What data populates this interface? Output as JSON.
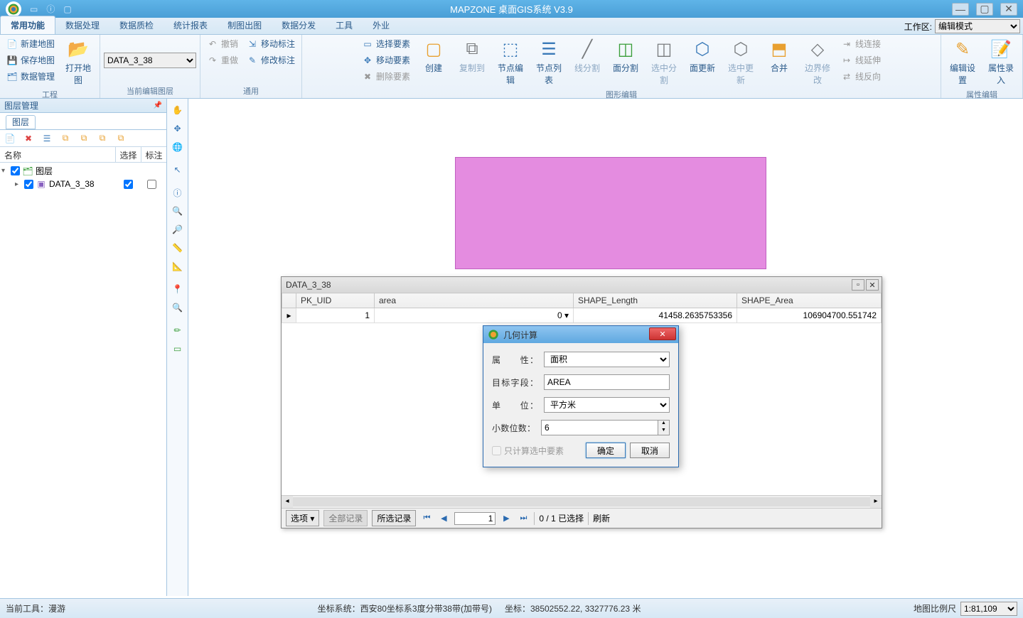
{
  "app": {
    "title": "MAPZONE 桌面GIS系统 V3.9"
  },
  "menu": {
    "tabs": [
      "常用功能",
      "数据处理",
      "数据质检",
      "统计报表",
      "制图出图",
      "数据分发",
      "工具",
      "外业"
    ],
    "active": 0,
    "workspace_label": "工作区:",
    "workspace_mode": "编辑模式"
  },
  "ribbon": {
    "groups": {
      "project": {
        "label": "工程",
        "new_map": "新建地图",
        "save_map": "保存地图",
        "data_mgmt": "数据管理",
        "open_map": "打开地图"
      },
      "edit_layer": {
        "label": "当前编辑图层",
        "layer": "DATA_3_38"
      },
      "general": {
        "label": "通用",
        "undo": "撤销",
        "redo": "重做",
        "move_label": "移动标注",
        "edit_label": "修改标注"
      },
      "shape_edit": {
        "label": "图形编辑",
        "select_feature": "选择要素",
        "move_feature": "移动要素",
        "delete_feature": "删除要素",
        "create": "创建",
        "copy_to": "复制到",
        "node_edit": "节点编辑",
        "node_list": "节点列表",
        "line_split": "线分割",
        "area_split": "面分割",
        "sel_split": "选中分割",
        "area_update": "面更新",
        "sel_update": "选中更新",
        "merge": "合并",
        "boundary_edit": "边界修改",
        "line_connect": "线连接",
        "line_extend": "线延伸",
        "line_reverse": "线反向"
      },
      "attr_edit": {
        "label": "属性编辑",
        "edit_settings": "编辑设置",
        "attr_input": "属性录入"
      }
    }
  },
  "layer_panel": {
    "title": "图层管理",
    "tab": "图层",
    "columns": {
      "name": "名称",
      "select": "选择",
      "label": "标注"
    },
    "root": "图层",
    "items": [
      {
        "name": "DATA_3_38",
        "selected": true,
        "labeled": false
      }
    ]
  },
  "attr_window": {
    "title": "DATA_3_38",
    "columns": [
      "PK_UID",
      "area",
      "SHAPE_Length",
      "SHAPE_Area"
    ],
    "rows": [
      {
        "pk": "1",
        "area": "0",
        "shape_length": "41458.2635753356",
        "shape_area": "106904700.551742"
      }
    ],
    "footer": {
      "options": "选项",
      "all_records": "全部记录",
      "selected_records": "所选记录",
      "page": "1",
      "selection_text": "0 / 1 已选择",
      "refresh": "刷新"
    }
  },
  "geom_dialog": {
    "title": "几何计算",
    "attribute_label": "属　　性",
    "attribute_value": "面积",
    "target_field_label": "目标字段",
    "target_field_value": "AREA",
    "unit_label": "单　　位",
    "unit_value": "平方米",
    "decimal_label": "小数位数",
    "decimal_value": "6",
    "only_selected": "只计算选中要素",
    "ok": "确定",
    "cancel": "取消"
  },
  "status": {
    "current_tool_label": "当前工具：",
    "current_tool": "漫游",
    "coord_system_label": "坐标系统：",
    "coord_system": "西安80坐标系3度分带38带(加带号)",
    "coord_label": "坐标：",
    "coord": "38502552.22, 3327776.23  米",
    "scale_label": "地图比例尺",
    "scale": "1:81,109"
  }
}
